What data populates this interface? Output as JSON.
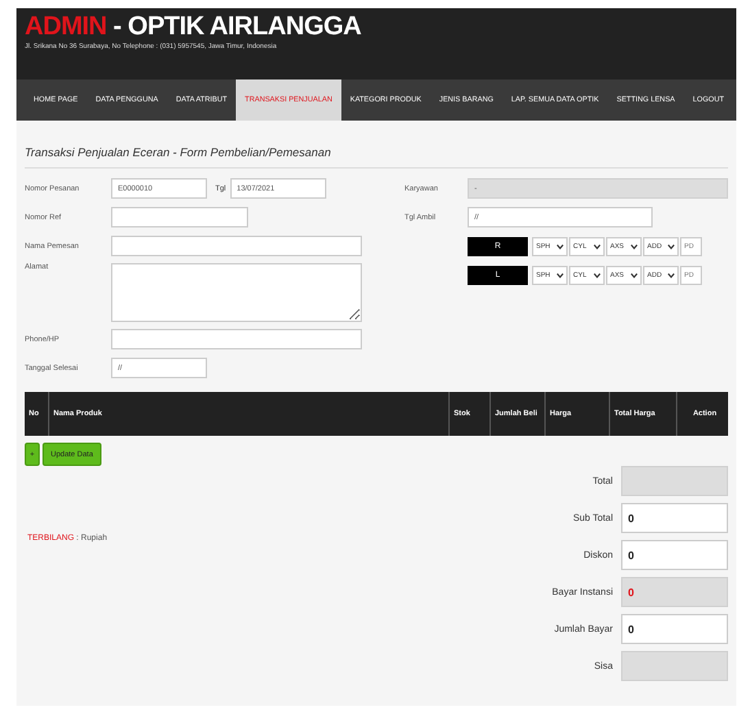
{
  "header": {
    "title_highlight": "ADMIN",
    "title": " - OPTIK AIRLANGGA",
    "address": "Jl. Srikana No 36 Surabaya, No Telephone : (031) 5957545, Jawa Timur, Indonesia"
  },
  "nav": [
    {
      "label": "HOME PAGE",
      "selected": false
    },
    {
      "label": "DATA PENGGUNA",
      "selected": false
    },
    {
      "label": "DATA ATRIBUT",
      "selected": false
    },
    {
      "label": "TRANSAKSI PENJUALAN",
      "selected": true
    },
    {
      "label": "KATEGORI PRODUK",
      "selected": false
    },
    {
      "label": "JENIS BARANG",
      "selected": false
    },
    {
      "label": "LAP. SEMUA DATA OPTIK",
      "selected": false
    },
    {
      "label": "SETTING LENSA",
      "selected": false
    },
    {
      "label": "LOGOUT",
      "selected": false
    }
  ],
  "form_title": "Transaksi Penjualan Eceran - Form Pembelian/Pemesanan",
  "left_fields": [
    {
      "label": "Nomor Pesanan",
      "kind": "order",
      "value": "E0000010",
      "date_label": "Tgl",
      "date_value": "13/07/2021"
    },
    {
      "label": "Nomor Ref",
      "kind": "short"
    },
    {
      "label": "Nama Pemesan",
      "kind": "long"
    },
    {
      "label": "Alamat",
      "kind": "textarea"
    },
    {
      "label": "Phone/HP",
      "kind": "long"
    },
    {
      "label": "Tanggal Selesai",
      "kind": "date",
      "value": "//"
    }
  ],
  "karyawan": {
    "label": "Karyawan",
    "value": "-",
    "disabled": true
  },
  "tgl_ambil": {
    "label": "Tgl Ambil",
    "value": "//"
  },
  "lens_rows": [
    {
      "eye": "R",
      "selects": [
        "SPH",
        "CYL",
        "AXS",
        "ADD"
      ],
      "placeholder": "PD"
    },
    {
      "eye": "L",
      "selects": [
        "SPH",
        "CYL",
        "AXS",
        "ADD"
      ],
      "placeholder": "PD"
    }
  ],
  "table": {
    "columns": [
      "No",
      "Nama Produk",
      "Stok",
      "Jumlah Beli",
      "Harga",
      "Total Harga",
      "Action"
    ]
  },
  "add_button": "+",
  "update_button": "Update Data",
  "terbilang": {
    "label": "TERBILANG",
    "value": " : Rupiah"
  },
  "summary": [
    {
      "label": "Total",
      "disabled": true
    },
    {
      "label": "Sub Total",
      "value": "0",
      "disabled": false
    },
    {
      "label": "Diskon",
      "value": "0",
      "disabled": false
    },
    {
      "label": "Bayar Instansi",
      "value": "0",
      "disabled": true,
      "alert": true
    },
    {
      "label": "Jumlah Bayar",
      "value": "0",
      "disabled": false
    },
    {
      "label": "Sisa",
      "disabled": true
    }
  ]
}
